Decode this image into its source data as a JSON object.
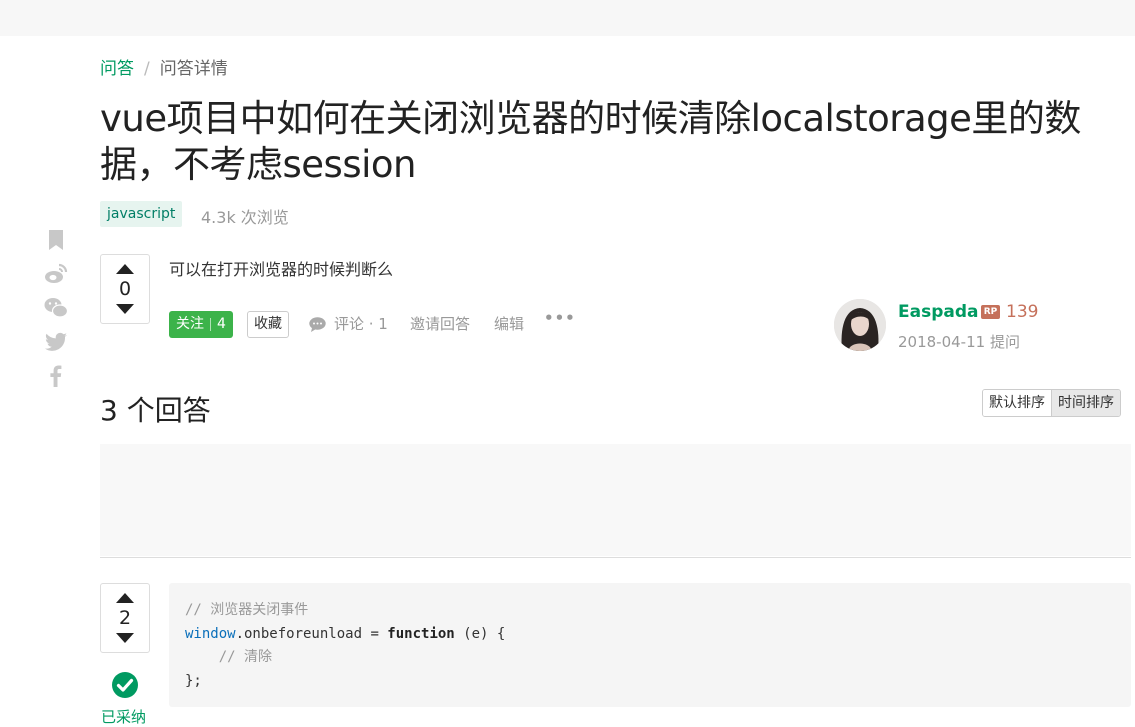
{
  "breadcrumb": {
    "home": "问答",
    "separator": "/",
    "current": "问答详情"
  },
  "question": {
    "title": "vue项目中如何在关闭浏览器的时候清除localstorage里的数据，不考虑session",
    "tag": "javascript",
    "views": "4.3k 次浏览",
    "votes": "0",
    "body": "可以在打开浏览器的时候判断么"
  },
  "actions": {
    "follow_label": "关注",
    "follow_count": "4",
    "collect_label": "收藏",
    "comment_label": "评论 · 1",
    "invite_label": "邀请回答",
    "edit_label": "编辑",
    "more_label": "•••"
  },
  "author": {
    "name": "Easpada",
    "rp_badge": "RP",
    "reputation": "139",
    "asked": "2018-04-11 提问"
  },
  "share_icons": [
    "bookmark-icon",
    "weibo-icon",
    "wechat-icon",
    "twitter-icon",
    "facebook-icon"
  ],
  "answers": {
    "title": "3 个回答",
    "sort_default": "默认排序",
    "sort_time": "时间排序"
  },
  "answer1": {
    "votes": "2",
    "accepted_label": "已采纳",
    "code_comment1": "// 浏览器关闭事件",
    "code_var": "window",
    "code_prop": ".onbeforeunload = ",
    "code_kw": "function",
    "code_args": " (e) {",
    "code_comment2": "    // 清除",
    "code_end": "};"
  },
  "colors": {
    "brand": "#009a61",
    "follow": "#3cb34a",
    "reputation": "#c5705a"
  }
}
